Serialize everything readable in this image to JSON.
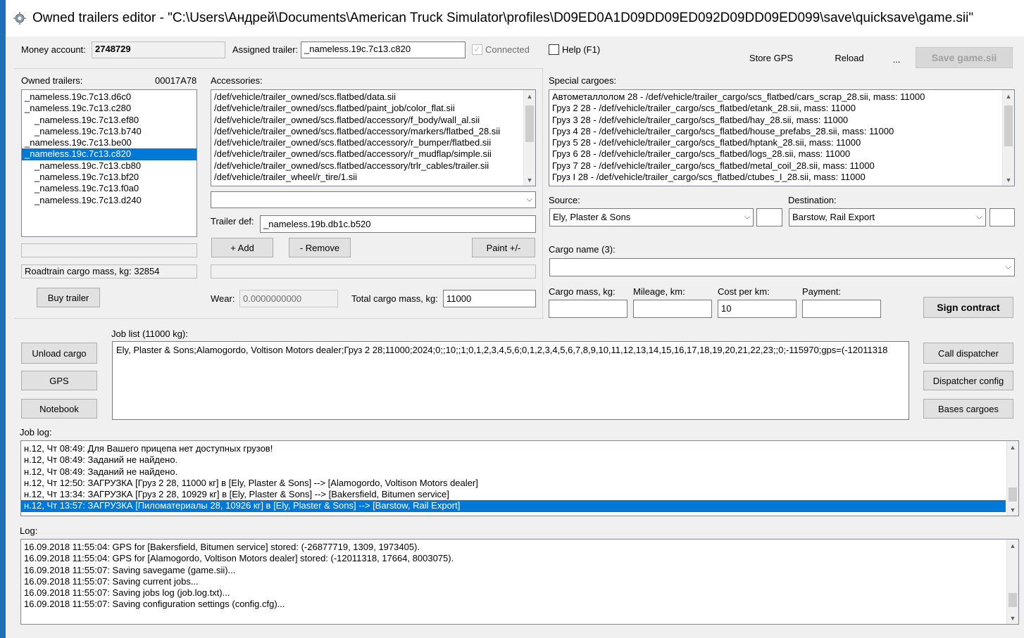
{
  "window": {
    "title": "Owned trailers editor - \"C:\\Users\\Андрей\\Documents\\American Truck Simulator\\profiles\\D09ED0A1D09DD09ED092D09DD09ED099\\save\\quicksave\\game.sii\"",
    "accent": "#0078d7"
  },
  "top": {
    "money_label": "Money account:",
    "money_value": "2748729",
    "assigned_label": "Assigned trailer:",
    "assigned_value": "_nameless.19c.7c13.c820",
    "connected_label": "Connected",
    "help_label": "Help (F1)",
    "store_gps": "Store GPS",
    "reload": "Reload",
    "ellipsis": "...",
    "save": "Save game.sii"
  },
  "owned": {
    "label": "Owned trailers:",
    "code": "00017A78",
    "items": [
      {
        "text": "_nameless.19c.7c13.d6c0",
        "indent": false,
        "selected": false
      },
      {
        "text": "_nameless.19c.7c13.c280",
        "indent": false,
        "selected": false
      },
      {
        "text": "_nameless.19c.7c13.ef80",
        "indent": true,
        "selected": false
      },
      {
        "text": "_nameless.19c.7c13.b740",
        "indent": true,
        "selected": false
      },
      {
        "text": "_nameless.19c.7c13.be00",
        "indent": false,
        "selected": false
      },
      {
        "text": "_nameless.19c.7c13.c820",
        "indent": false,
        "selected": true
      },
      {
        "text": "_nameless.19c.7c13.cb80",
        "indent": true,
        "selected": false
      },
      {
        "text": "_nameless.19c.7c13.bf20",
        "indent": true,
        "selected": false
      },
      {
        "text": "_nameless.19c.7c13.f0a0",
        "indent": true,
        "selected": false
      },
      {
        "text": "_nameless.19c.7c13.d240",
        "indent": true,
        "selected": false
      }
    ],
    "roadtrain": "Roadtrain cargo mass, kg: 32854",
    "buy": "Buy trailer"
  },
  "accessories": {
    "label": "Accessories:",
    "items": [
      "/def/vehicle/trailer_owned/scs.flatbed/data.sii",
      "/def/vehicle/trailer_owned/scs.flatbed/paint_job/color_flat.sii",
      "/def/vehicle/trailer_owned/scs.flatbed/accessory/f_body/wall_al.sii",
      "/def/vehicle/trailer_owned/scs.flatbed/accessory/markers/flatbed_28.sii",
      "/def/vehicle/trailer_owned/scs.flatbed/accessory/r_bumper/flatbed.sii",
      "/def/vehicle/trailer_owned/scs.flatbed/accessory/r_mudflap/simple.sii",
      "/def/vehicle/trailer_owned/scs.flatbed/accessory/trlr_cables/trailer.sii",
      "/def/vehicle/trailer_wheel/r_tire/1.sii"
    ],
    "trailer_def_label": "Trailer def:",
    "trailer_def_value": "_nameless.19b.db1c.b520",
    "add": "+ Add",
    "remove": "- Remove",
    "paint": "Paint +/-",
    "wear_label": "Wear:",
    "wear_value": "0.0000000000",
    "total_label": "Total cargo mass, kg:",
    "total_value": "11000"
  },
  "special": {
    "label": "Special cargoes:",
    "items": [
      "Автометаллолом 28  -  /def/vehicle/trailer_cargo/scs_flatbed/cars_scrap_28.sii, mass: 11000",
      "Груз 2 28  -  /def/vehicle/trailer_cargo/scs_flatbed/etank_28.sii, mass: 11000",
      "Груз 3 28  -  /def/vehicle/trailer_cargo/scs_flatbed/hay_28.sii, mass: 11000",
      "Груз 4 28  -  /def/vehicle/trailer_cargo/scs_flatbed/house_prefabs_28.sii, mass: 11000",
      "Груз 5 28  -  /def/vehicle/trailer_cargo/scs_flatbed/hptank_28.sii, mass: 11000",
      "Груз 6 28  -  /def/vehicle/trailer_cargo/scs_flatbed/logs_28.sii, mass: 11000",
      "Груз 7 28  -  /def/vehicle/trailer_cargo/scs_flatbed/metal_coil_28.sii, mass: 11000",
      "Груз I 28  -  /def/vehicle/trailer_cargo/scs_flatbed/ctubes_I_28.sii, mass: 11000"
    ],
    "source_label": "Source:",
    "source_value": "Ely, Plaster & Sons",
    "dest_label": "Destination:",
    "dest_value": "Barstow, Rail Export",
    "cargo_name_label": "Cargo name (3):",
    "cargo_mass_label": "Cargo mass, kg:",
    "mileage_label": "Mileage, km:",
    "cost_label": "Cost per km:",
    "cost_value": "10",
    "payment_label": "Payment:",
    "sign": "Sign contract"
  },
  "jobs": {
    "label": "Job list (11000 kg):",
    "text": "Ely, Plaster & Sons;Alamogordo, Voltison Motors dealer;Груз 2 28;11000;2024;0;;10;;1;0,1,2,3,4,5,6;0,1,2,3,4,5,6,7,8,9,10,11,12,13,14,15,16,17,18,19,20,21,22,23;;0;-115970;gps=(-12011318",
    "unload": "Unload cargo",
    "gps": "GPS",
    "notebook": "Notebook",
    "call": "Call dispatcher",
    "config": "Dispatcher config",
    "bases": "Bases cargoes"
  },
  "joblog": {
    "label": "Job log:",
    "items": [
      {
        "text": "н.12, Чт 08:49:  Для Вашего прицепа нет доступных грузов!",
        "selected": false
      },
      {
        "text": "н.12, Чт 08:49:  Заданий не найдено.",
        "selected": false
      },
      {
        "text": "н.12, Чт 08:49:  Заданий не найдено.",
        "selected": false
      },
      {
        "text": "н.12, Чт 12:50:  ЗАГРУЗКА [Груз 2 28, 11000 кг] в [Ely, Plaster & Sons] --> [Alamogordo, Voltison Motors dealer]",
        "selected": false
      },
      {
        "text": "н.12, Чт 13:34:  ЗАГРУЗКА [Груз 2 28, 10929 кг] в [Ely, Plaster & Sons] --> [Bakersfield, Bitumen service]",
        "selected": false
      },
      {
        "text": "н.12, Чт 13:57:  ЗАГРУЗКА [Пиломатериалы 28, 10926 кг] в [Ely, Plaster & Sons] --> [Barstow, Rail Export]",
        "selected": true
      }
    ]
  },
  "log": {
    "label": "Log:",
    "items": [
      "16.09.2018 11:55:04: GPS for [Bakersfield, Bitumen service] stored: (-26877719, 1309, 1973405).",
      "16.09.2018 11:55:04: GPS for [Alamogordo, Voltison Motors dealer] stored: (-12011318, 17664, 8003075).",
      "16.09.2018 11:55:07: Saving savegame (game.sii)...",
      "16.09.2018 11:55:07: Saving current jobs...",
      "16.09.2018 11:55:07: Saving jobs log (job.log.txt)...",
      "16.09.2018 11:55:07: Saving configuration settings (config.cfg)..."
    ]
  }
}
